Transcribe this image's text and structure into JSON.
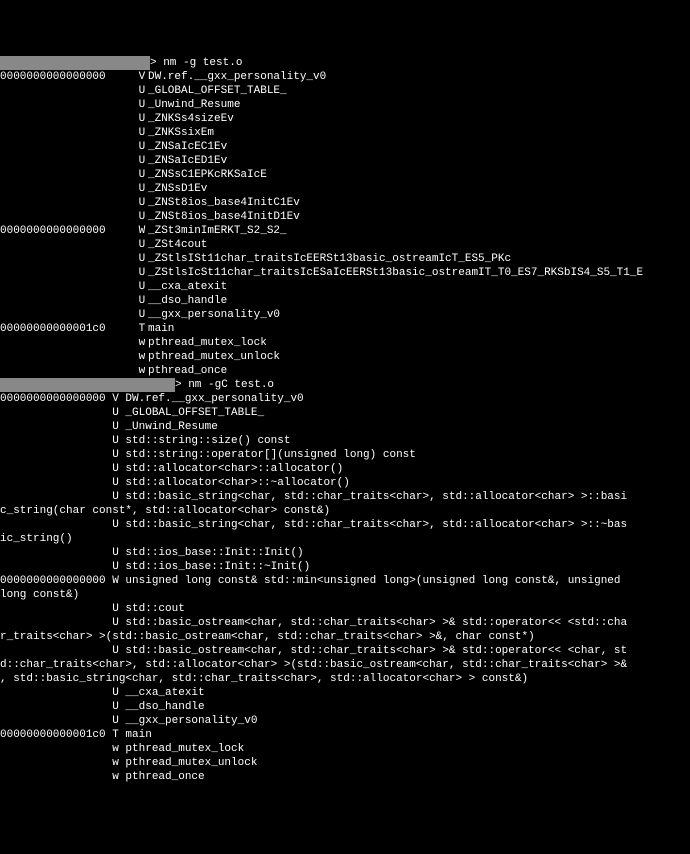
{
  "prompt1": {
    "marker": "> ",
    "command": "nm -g test.o"
  },
  "block1": [
    {
      "addr": "0000000000000000",
      "type": "V",
      "sym": "DW.ref.__gxx_personality_v0"
    },
    {
      "addr": "",
      "type": "U",
      "sym": "_GLOBAL_OFFSET_TABLE_"
    },
    {
      "addr": "",
      "type": "U",
      "sym": "_Unwind_Resume"
    },
    {
      "addr": "",
      "type": "U",
      "sym": "_ZNKSs4sizeEv"
    },
    {
      "addr": "",
      "type": "U",
      "sym": "_ZNKSsixEm"
    },
    {
      "addr": "",
      "type": "U",
      "sym": "_ZNSaIcEC1Ev"
    },
    {
      "addr": "",
      "type": "U",
      "sym": "_ZNSaIcED1Ev"
    },
    {
      "addr": "",
      "type": "U",
      "sym": "_ZNSsC1EPKcRKSaIcE"
    },
    {
      "addr": "",
      "type": "U",
      "sym": "_ZNSsD1Ev"
    },
    {
      "addr": "",
      "type": "U",
      "sym": "_ZNSt8ios_base4InitC1Ev"
    },
    {
      "addr": "",
      "type": "U",
      "sym": "_ZNSt8ios_base4InitD1Ev"
    },
    {
      "addr": "0000000000000000",
      "type": "W",
      "sym": "_ZSt3minImERKT_S2_S2_"
    },
    {
      "addr": "",
      "type": "U",
      "sym": "_ZSt4cout"
    },
    {
      "addr": "",
      "type": "U",
      "sym": "_ZStlsISt11char_traitsIcEERSt13basic_ostreamIcT_ES5_PKc"
    },
    {
      "addr": "",
      "type": "U",
      "sym": "_ZStlsIcSt11char_traitsIcESaIcEERSt13basic_ostreamIT_T0_ES7_RKSbIS4_S5_T1_E"
    },
    {
      "addr": "",
      "type": "U",
      "sym": "__cxa_atexit"
    },
    {
      "addr": "",
      "type": "U",
      "sym": "__dso_handle"
    },
    {
      "addr": "",
      "type": "U",
      "sym": "__gxx_personality_v0"
    },
    {
      "addr": "00000000000001c0",
      "type": "T",
      "sym": "main"
    },
    {
      "addr": "",
      "type": "w",
      "sym": "pthread_mutex_lock"
    },
    {
      "addr": "",
      "type": "w",
      "sym": "pthread_mutex_unlock"
    },
    {
      "addr": "",
      "type": "w",
      "sym": "pthread_once"
    }
  ],
  "prompt2": {
    "marker": "> ",
    "command": "nm -gC test.o"
  },
  "block2_lines": [
    "0000000000000000 V DW.ref.__gxx_personality_v0",
    "                 U _GLOBAL_OFFSET_TABLE_",
    "                 U _Unwind_Resume",
    "                 U std::string::size() const",
    "                 U std::string::operator[](unsigned long) const",
    "                 U std::allocator<char>::allocator()",
    "                 U std::allocator<char>::~allocator()",
    "                 U std::basic_string<char, std::char_traits<char>, std::allocator<char> >::basi",
    "c_string(char const*, std::allocator<char> const&)",
    "                 U std::basic_string<char, std::char_traits<char>, std::allocator<char> >::~bas",
    "ic_string()",
    "                 U std::ios_base::Init::Init()",
    "                 U std::ios_base::Init::~Init()",
    "0000000000000000 W unsigned long const& std::min<unsigned long>(unsigned long const&, unsigned ",
    "long const&)",
    "                 U std::cout",
    "                 U std::basic_ostream<char, std::char_traits<char> >& std::operator<< <std::cha",
    "r_traits<char> >(std::basic_ostream<char, std::char_traits<char> >&, char const*)",
    "                 U std::basic_ostream<char, std::char_traits<char> >& std::operator<< <char, st",
    "d::char_traits<char>, std::allocator<char> >(std::basic_ostream<char, std::char_traits<char> >&",
    ", std::basic_string<char, std::char_traits<char>, std::allocator<char> > const&)",
    "                 U __cxa_atexit",
    "                 U __dso_handle",
    "                 U __gxx_personality_v0",
    "00000000000001c0 T main",
    "                 w pthread_mutex_lock",
    "                 w pthread_mutex_unlock",
    "                 w pthread_once"
  ]
}
